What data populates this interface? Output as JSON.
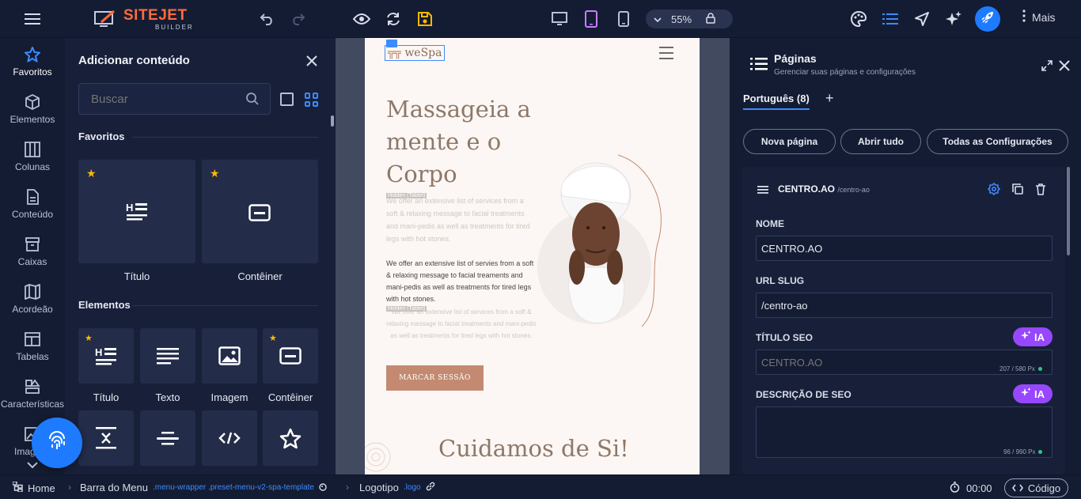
{
  "topbar": {
    "logo_name": "SITEJET",
    "logo_sub": "BUILDER",
    "zoom": "55%",
    "more_label": "Mais",
    "brand_color": "#ff6b3d",
    "accent_color": "#1e7bff"
  },
  "rail": {
    "items": [
      {
        "label": "Favoritos",
        "icon": "star-icon"
      },
      {
        "label": "Elementos",
        "icon": "cube-icon"
      },
      {
        "label": "Colunas",
        "icon": "columns-icon"
      },
      {
        "label": "Conteúdo",
        "icon": "document-icon"
      },
      {
        "label": "Caixas",
        "icon": "box-icon"
      },
      {
        "label": "Acordeão",
        "icon": "accordion-icon"
      },
      {
        "label": "Tabelas",
        "icon": "table-icon"
      },
      {
        "label": "Características",
        "icon": "features-icon"
      },
      {
        "label": "Imagens",
        "icon": "image-icon"
      }
    ]
  },
  "addpanel": {
    "title": "Adicionar conteúdo",
    "search_placeholder": "Buscar",
    "favorites_title": "Favoritos",
    "favorites": [
      {
        "label": "Título",
        "icon": "heading-icon"
      },
      {
        "label": "Contêiner",
        "icon": "container-icon"
      }
    ],
    "elements_title": "Elementos",
    "elements": [
      {
        "label": "Título",
        "icon": "heading-icon",
        "favorite": true
      },
      {
        "label": "Texto",
        "icon": "text-icon",
        "favorite": false
      },
      {
        "label": "Imagem",
        "icon": "image-icon",
        "favorite": false
      },
      {
        "label": "Contêiner",
        "icon": "container-icon",
        "favorite": true
      },
      {
        "label": "",
        "icon": "spacer-icon",
        "favorite": false
      },
      {
        "label": "",
        "icon": "divider-icon",
        "favorite": false
      },
      {
        "label": "",
        "icon": "code-icon",
        "favorite": false
      },
      {
        "label": "",
        "icon": "star-outline-icon",
        "favorite": false
      }
    ]
  },
  "preview": {
    "brand": "weSpa",
    "hero_title": "Massageia a mente e o Corpo",
    "hidden_tag": "Hidden (Tablet)",
    "faded_text": "We offer an extensive list of services from a soft & relaxing message to facial treatments and mani-pedis as well as treatments for tired legs with hot stones.",
    "body_text": "We offer an extensive list of servies from a soft & relaxing message to facial treaments and mani-pedis as well as treatments for tired legs with hot stones.",
    "cta": "MARCAR SESSÃO",
    "section_heading": "Cuidamos de Si!"
  },
  "pages": {
    "title": "Páginas",
    "subtitle": "Gerenciar suas páginas e configurações",
    "tab": "Português (8)",
    "btn_new": "Nova página",
    "btn_open_all": "Abrir tudo",
    "btn_settings": "Todas as Configurações",
    "page_name": "CENTRO.AO",
    "page_slug_small": "/centro-ao",
    "name_label": "NOME",
    "name_value": "CENTRO.AO",
    "slug_label": "URL SLUG",
    "slug_value": "/centro-ao",
    "seo_title_label": "TÍTULO SEO",
    "seo_title_placeholder": "CENTRO.AO",
    "seo_title_counter": "207 / 580 Px",
    "seo_desc_label": "DESCRIÇÃO DE SEO",
    "seo_desc_counter": "96 / 990 Px",
    "ai_label": "IA"
  },
  "bottombar": {
    "crumbs": [
      {
        "label": "Home",
        "cls": ""
      },
      {
        "label": "Barra do Menu",
        "cls": ".menu-wrapper .preset-menu-v2-spa-template"
      },
      {
        "label": "Logotipo",
        "cls": ".logo"
      }
    ],
    "time": "00:00",
    "code_label": "Código"
  }
}
